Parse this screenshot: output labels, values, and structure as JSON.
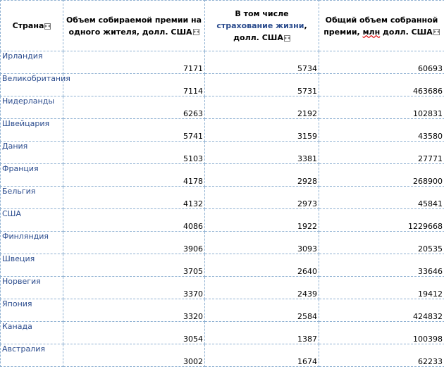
{
  "headers": {
    "country": "Страна",
    "per_capita": "Объем собираемой премии на одного жителя, долл. США",
    "life_prefix": "В том числе ",
    "life_link": "страхование жизни",
    "life_suffix": ", долл. США",
    "total_prefix": "Общий объем собранной премии, ",
    "total_underlined": "млн",
    "total_suffix": " долл. США"
  },
  "rows": [
    {
      "country": "Ирландия",
      "per_capita": "7171",
      "life": "5734",
      "total": "60693"
    },
    {
      "country": "Великобритания",
      "per_capita": "7114",
      "life": "5731",
      "total": "463686"
    },
    {
      "country": "Нидерланды",
      "per_capita": "6263",
      "life": "2192",
      "total": "102831"
    },
    {
      "country": "Швейцария",
      "per_capita": "5741",
      "life": "3159",
      "total": "43580"
    },
    {
      "country": "Дания",
      "per_capita": "5103",
      "life": "3381",
      "total": "27771"
    },
    {
      "country": "Франция",
      "per_capita": "4178",
      "life": "2928",
      "total": "268900"
    },
    {
      "country": "Бельгия",
      "per_capita": "4132",
      "life": "2973",
      "total": "45841"
    },
    {
      "country": "США",
      "per_capita": "4086",
      "life": "1922",
      "total": "1229668"
    },
    {
      "country": "Финляндия",
      "per_capita": "3906",
      "life": "3093",
      "total": "20535"
    },
    {
      "country": "Швеция",
      "per_capita": "3705",
      "life": "2640",
      "total": "33646"
    },
    {
      "country": "Норвегия",
      "per_capita": "3370",
      "life": "2439",
      "total": "19412"
    },
    {
      "country": "Япония",
      "per_capita": "3320",
      "life": "2584",
      "total": "424832"
    },
    {
      "country": "Канада",
      "per_capita": "3054",
      "life": "1387",
      "total": "100398"
    },
    {
      "country": "Австралия",
      "per_capita": "3002",
      "life": "1674",
      "total": "62233"
    }
  ]
}
